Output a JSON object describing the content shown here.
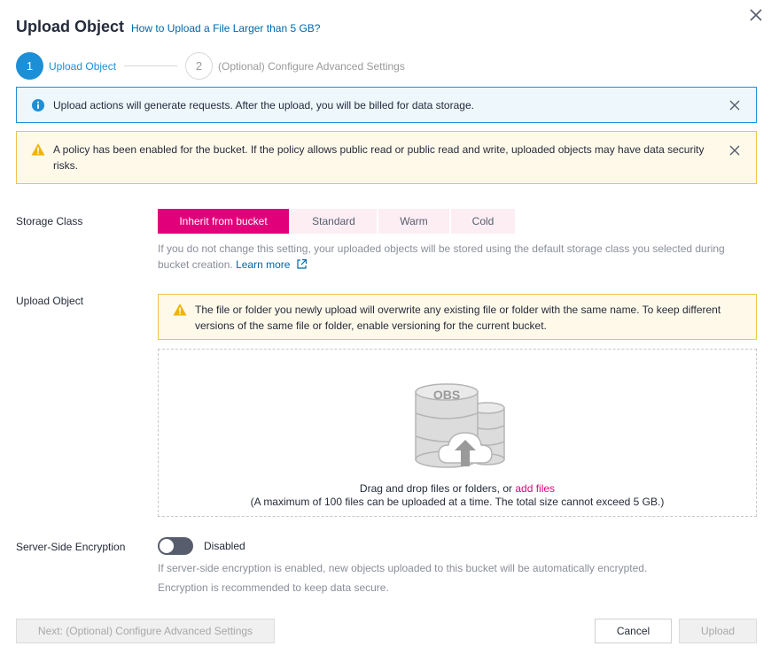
{
  "header": {
    "title": "Upload Object",
    "help_link": "How to Upload a File Larger than 5 GB?",
    "close_icon": "close-icon"
  },
  "steps": [
    {
      "number": "1",
      "label": "Upload Object",
      "state": "active"
    },
    {
      "number": "2",
      "label": "(Optional) Configure Advanced Settings",
      "state": "inactive"
    }
  ],
  "alerts": {
    "info_text": "Upload actions will generate requests. After the upload, you will be billed for data storage.",
    "warning_text": "A policy has been enabled for the bucket. If the policy allows public read or public read and write, uploaded objects may have data security risks."
  },
  "storage_class": {
    "label": "Storage Class",
    "options": [
      "Inherit from bucket",
      "Standard",
      "Warm",
      "Cold"
    ],
    "selected": "Inherit from bucket",
    "hint": "If you do not change this setting, your uploaded objects will be stored using the default storage class you selected during bucket creation.",
    "learn_more": "Learn more"
  },
  "upload_object": {
    "label": "Upload Object",
    "warning": "The file or folder you newly upload will overwrite any existing file or folder with the same name. To keep different versions of the same file or folder, enable versioning for the current bucket.",
    "illustration_label": "OBS",
    "drop_text": "Drag and drop files or folders, or",
    "add_files": "add files",
    "limit_text": "(A maximum of 100 files can be uploaded at a time. The total size cannot exceed 5 GB.)"
  },
  "encryption": {
    "label": "Server-Side Encryption",
    "state": "Disabled",
    "hint_1": "If server-side encryption is enabled, new objects uploaded to this bucket will be automatically encrypted.",
    "hint_2": "Encryption is recommended to keep data secure."
  },
  "footer": {
    "next_label": "Next: (Optional) Configure Advanced Settings",
    "cancel_label": "Cancel",
    "upload_label": "Upload"
  },
  "colors": {
    "accent": "#e2007a",
    "step_active": "#1d8fd6",
    "link": "#0066a8",
    "warning": "#f0c34a"
  }
}
